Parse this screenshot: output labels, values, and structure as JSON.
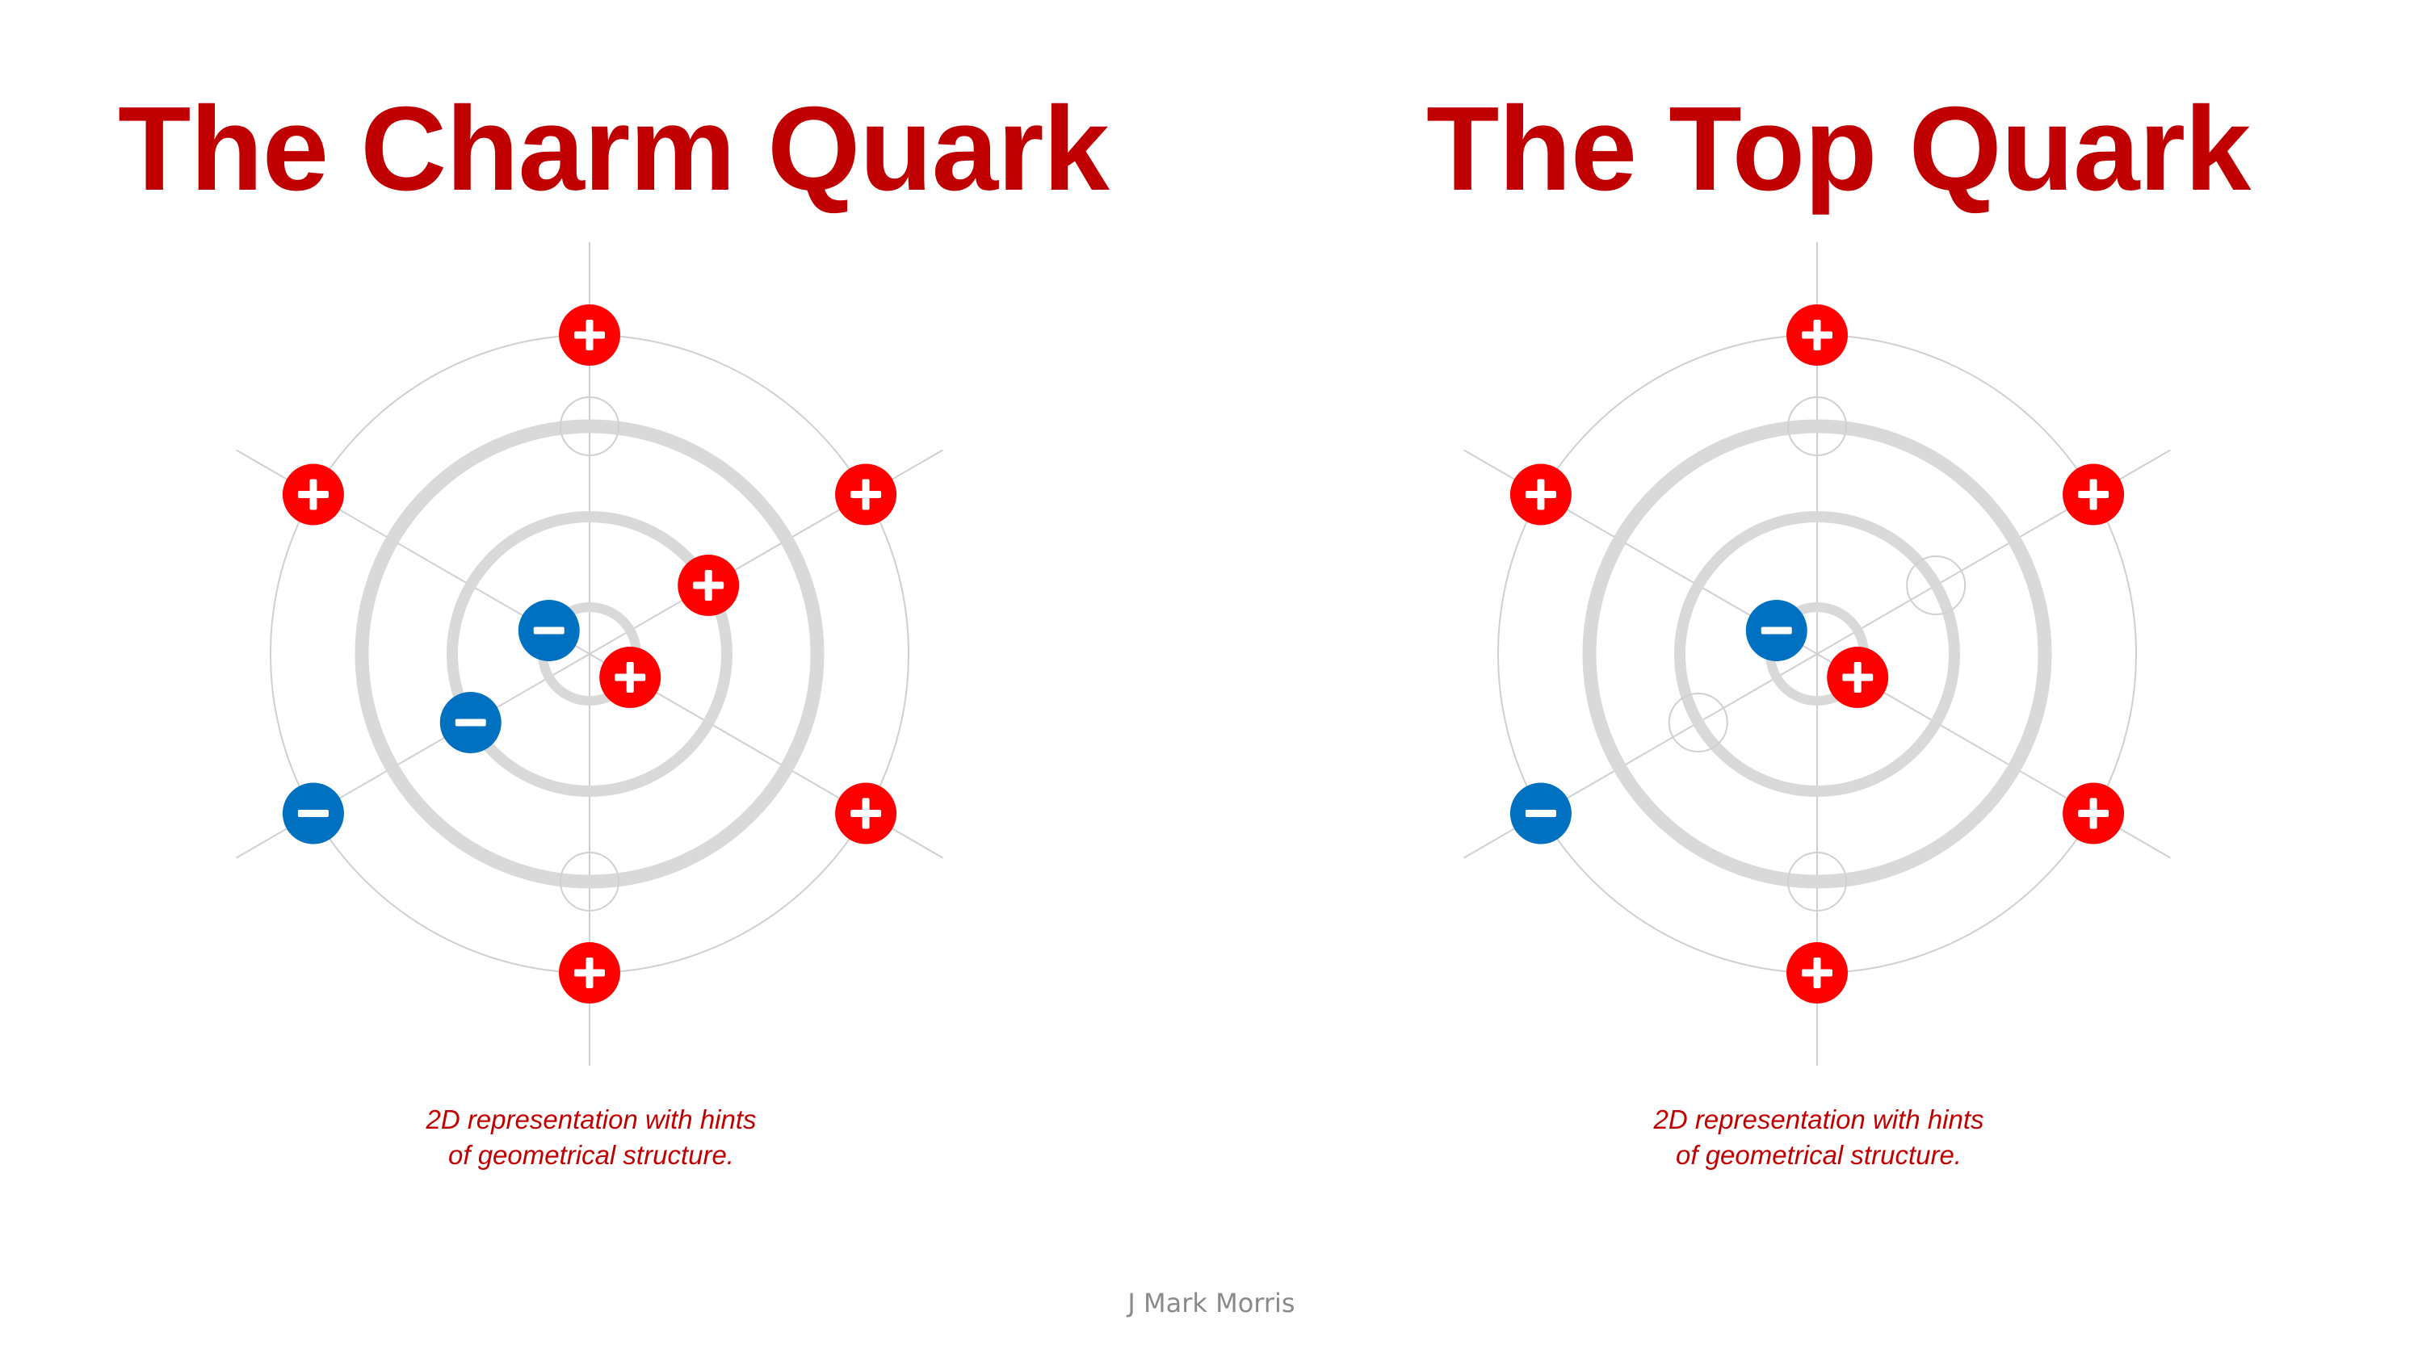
{
  "panels": [
    {
      "title": "The Charm Quark",
      "caption_line1": "2D representation with hints",
      "caption_line2": "of geometrical structure.",
      "particles": [
        {
          "id": "outer-top",
          "charge": "+"
        },
        {
          "id": "outer-upper-left",
          "charge": "+"
        },
        {
          "id": "outer-upper-right",
          "charge": "+"
        },
        {
          "id": "outer-lower-left",
          "charge": "-"
        },
        {
          "id": "outer-lower-right",
          "charge": "+"
        },
        {
          "id": "outer-bottom",
          "charge": "+"
        },
        {
          "id": "middle-upper-right",
          "charge": "+"
        },
        {
          "id": "middle-lower-left",
          "charge": "-"
        },
        {
          "id": "inner-upper-left",
          "charge": "-"
        },
        {
          "id": "inner-lower-right",
          "charge": "+"
        }
      ]
    },
    {
      "title": "The Top Quark",
      "caption_line1": "2D representation with hints",
      "caption_line2": "of geometrical structure.",
      "particles": [
        {
          "id": "outer-top",
          "charge": "+"
        },
        {
          "id": "outer-upper-left",
          "charge": "+"
        },
        {
          "id": "outer-upper-right",
          "charge": "+"
        },
        {
          "id": "outer-lower-left",
          "charge": "-"
        },
        {
          "id": "outer-lower-right",
          "charge": "+"
        },
        {
          "id": "outer-bottom",
          "charge": "+"
        },
        {
          "id": "middle-upper-right",
          "charge": "empty"
        },
        {
          "id": "middle-lower-left",
          "charge": "empty"
        },
        {
          "id": "inner-upper-left",
          "charge": "-"
        },
        {
          "id": "inner-lower-right",
          "charge": "+"
        }
      ]
    }
  ],
  "author": "J Mark Morris",
  "colors": {
    "title": "#c00000",
    "positive": "#ff0000",
    "negative": "#0070c0",
    "ring_thick": "#d9d9d9",
    "ring_thin": "#d0d0d0",
    "author": "#8a8a8a"
  }
}
